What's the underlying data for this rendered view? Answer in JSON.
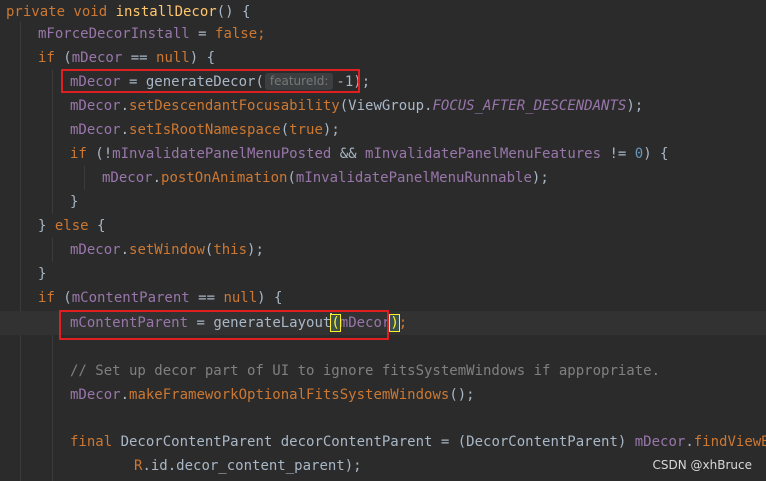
{
  "code_lines": [
    {
      "tokens": [
        {
          "t": "private void ",
          "c": "kw"
        },
        {
          "t": "installDecor",
          "c": "fn"
        },
        {
          "t": "() {",
          "c": "plain"
        }
      ]
    },
    {
      "tokens": [
        {
          "t": "mForceDecorInstall",
          "c": "field"
        },
        {
          "t": " = ",
          "c": "plain"
        },
        {
          "t": "false",
          "c": "kw"
        },
        {
          "t": ";",
          "c": "kw"
        }
      ]
    },
    {
      "tokens": [
        {
          "t": "if",
          "c": "kw"
        },
        {
          "t": " (",
          "c": "plain"
        },
        {
          "t": "mDecor",
          "c": "field"
        },
        {
          "t": " == ",
          "c": "plain"
        },
        {
          "t": "null",
          "c": "kw"
        },
        {
          "t": ") {",
          "c": "plain"
        }
      ]
    },
    {
      "tokens": [
        {
          "t": "mDecor",
          "c": "field"
        },
        {
          "t": " = ",
          "c": "plain"
        },
        {
          "t": "generateDecor(",
          "c": "plain"
        },
        {
          "t": "featureId:",
          "c": "hint"
        },
        {
          "t": "-1",
          "c": "plain"
        },
        {
          "t": ");",
          "c": "plain"
        }
      ]
    },
    {
      "tokens": [
        {
          "t": "mDecor",
          "c": "field"
        },
        {
          "t": ".",
          "c": "plain"
        },
        {
          "t": "setDescendantFocusability",
          "c": "method"
        },
        {
          "t": "(ViewGroup.",
          "c": "plain"
        },
        {
          "t": "FOCUS_AFTER_DESCENDANTS",
          "c": "const"
        },
        {
          "t": ");",
          "c": "plain"
        }
      ]
    },
    {
      "tokens": [
        {
          "t": "mDecor",
          "c": "field"
        },
        {
          "t": ".",
          "c": "plain"
        },
        {
          "t": "setIsRootNamespace",
          "c": "method"
        },
        {
          "t": "(",
          "c": "plain"
        },
        {
          "t": "true",
          "c": "kw"
        },
        {
          "t": ");",
          "c": "plain"
        }
      ]
    },
    {
      "tokens": [
        {
          "t": "if",
          "c": "kw"
        },
        {
          "t": " (!",
          "c": "plain"
        },
        {
          "t": "mInvalidatePanelMenuPosted",
          "c": "field"
        },
        {
          "t": " && ",
          "c": "plain"
        },
        {
          "t": "mInvalidatePanelMenuFeatures",
          "c": "field"
        },
        {
          "t": " != ",
          "c": "plain"
        },
        {
          "t": "0",
          "c": "num"
        },
        {
          "t": ") {",
          "c": "plain"
        }
      ]
    },
    {
      "tokens": [
        {
          "t": "mDecor",
          "c": "field"
        },
        {
          "t": ".",
          "c": "plain"
        },
        {
          "t": "postOnAnimation",
          "c": "method"
        },
        {
          "t": "(",
          "c": "plain"
        },
        {
          "t": "mInvalidatePanelMenuRunnable",
          "c": "field"
        },
        {
          "t": ");",
          "c": "plain"
        }
      ]
    },
    {
      "tokens": [
        {
          "t": "}",
          "c": "plain"
        }
      ]
    },
    {
      "tokens": [
        {
          "t": "} ",
          "c": "plain"
        },
        {
          "t": "else",
          "c": "kw"
        },
        {
          "t": " {",
          "c": "plain"
        }
      ]
    },
    {
      "tokens": [
        {
          "t": "mDecor",
          "c": "field"
        },
        {
          "t": ".",
          "c": "plain"
        },
        {
          "t": "setWindow",
          "c": "method"
        },
        {
          "t": "(",
          "c": "plain"
        },
        {
          "t": "this",
          "c": "kw"
        },
        {
          "t": ");",
          "c": "plain"
        }
      ]
    },
    {
      "tokens": [
        {
          "t": "}",
          "c": "plain"
        }
      ]
    },
    {
      "tokens": [
        {
          "t": "if",
          "c": "kw"
        },
        {
          "t": " (",
          "c": "plain"
        },
        {
          "t": "mContentParent",
          "c": "field"
        },
        {
          "t": " == ",
          "c": "plain"
        },
        {
          "t": "null",
          "c": "kw"
        },
        {
          "t": ") {",
          "c": "plain"
        }
      ]
    },
    {
      "tokens": [
        {
          "t": "mContentParent",
          "c": "field"
        },
        {
          "t": " = ",
          "c": "plain"
        },
        {
          "t": "generateLayout",
          "c": "plain"
        },
        {
          "t": "(",
          "c": "bracket"
        },
        {
          "t": "mDecor",
          "c": "field"
        },
        {
          "t": ")",
          "c": "bracket"
        },
        {
          "t": ";",
          "c": "kw"
        }
      ]
    },
    {
      "tokens": []
    },
    {
      "tokens": [
        {
          "t": "// Set up decor part of UI to ignore fitsSystemWindows if appropriate.",
          "c": "comment"
        }
      ]
    },
    {
      "tokens": [
        {
          "t": "mDecor",
          "c": "field"
        },
        {
          "t": ".",
          "c": "plain"
        },
        {
          "t": "makeFrameworkOptionalFitsSystemWindows",
          "c": "method"
        },
        {
          "t": "();",
          "c": "plain"
        }
      ]
    },
    {
      "tokens": []
    },
    {
      "tokens": [
        {
          "t": "final ",
          "c": "kw"
        },
        {
          "t": "DecorContentParent decorContentParent = (DecorContentParent) ",
          "c": "plain"
        },
        {
          "t": "mDecor",
          "c": "field"
        },
        {
          "t": ".",
          "c": "plain"
        },
        {
          "t": "findViewById",
          "c": "method"
        },
        {
          "t": "(",
          "c": "plain"
        }
      ]
    },
    {
      "tokens": [
        {
          "t": "R",
          "c": "rfield"
        },
        {
          "t": ".id.decor_content_parent);",
          "c": "plain"
        }
      ]
    }
  ],
  "watermark": "CSDN @xhBruce",
  "colors": {
    "background": "#2b2b2b",
    "keyword": "#cc7832",
    "field": "#9876aa",
    "function": "#ffc66d",
    "comment": "#808080",
    "number": "#6897bb",
    "highlight_box": "#e02020"
  }
}
